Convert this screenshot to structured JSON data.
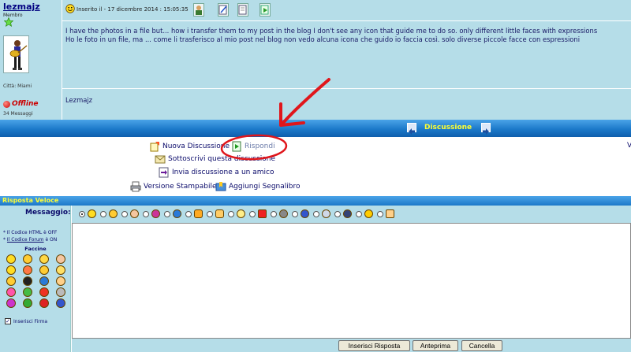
{
  "author": {
    "name": "lezmajz",
    "role": "Membro",
    "city": "Città: Miami",
    "status": "Offline",
    "message_count": "34 Messaggi"
  },
  "post": {
    "date": "Inserito il - 17 dicembre 2014 : 15:05:35",
    "body_line1": "I have the photos in a file but... how i transfer them to my post in the blog I don't see any icon that guide me to do so. only different little faces with expressions",
    "body_line2": "Ho le foto in un file, ma ... come li trasferisco al mio post nel blog non vedo alcuna icona che guido io faccia così. solo diverse piccole facce con espressioni",
    "signature": "Lezmajz"
  },
  "nav": {
    "title": "Discussione"
  },
  "actions": {
    "new_topic": "Nuova Discussione",
    "reply": "Rispondi",
    "subscribe": "Sottoscrivi questa discussione",
    "send_friend": "Invia discussione a un amico",
    "print": "Versione Stampabile",
    "bookmark": "Aggiungi Segnalibro",
    "right_char": "V"
  },
  "quick_reply": {
    "title": "Risposta Veloce",
    "message_label": "Messaggio:",
    "html_code_prefix": "* Il Codice HTML è ",
    "html_code_state": "OFF",
    "forum_code_prefix": "* ",
    "forum_code_link": "Il Codice Forum",
    "forum_code_suffix": " è ON",
    "emoticons_label": "Faccine",
    "signature_label": "Inserisci Firma",
    "buttons": {
      "submit": "Inserisci Risposta",
      "preview": "Anteprima",
      "cancel": "Cancella"
    }
  },
  "colors": {
    "panel_bg": "#b5dde8",
    "nav_blue": "#1c79c9",
    "title_yellow": "#ffff33",
    "annotation_red": "#e0161b"
  }
}
